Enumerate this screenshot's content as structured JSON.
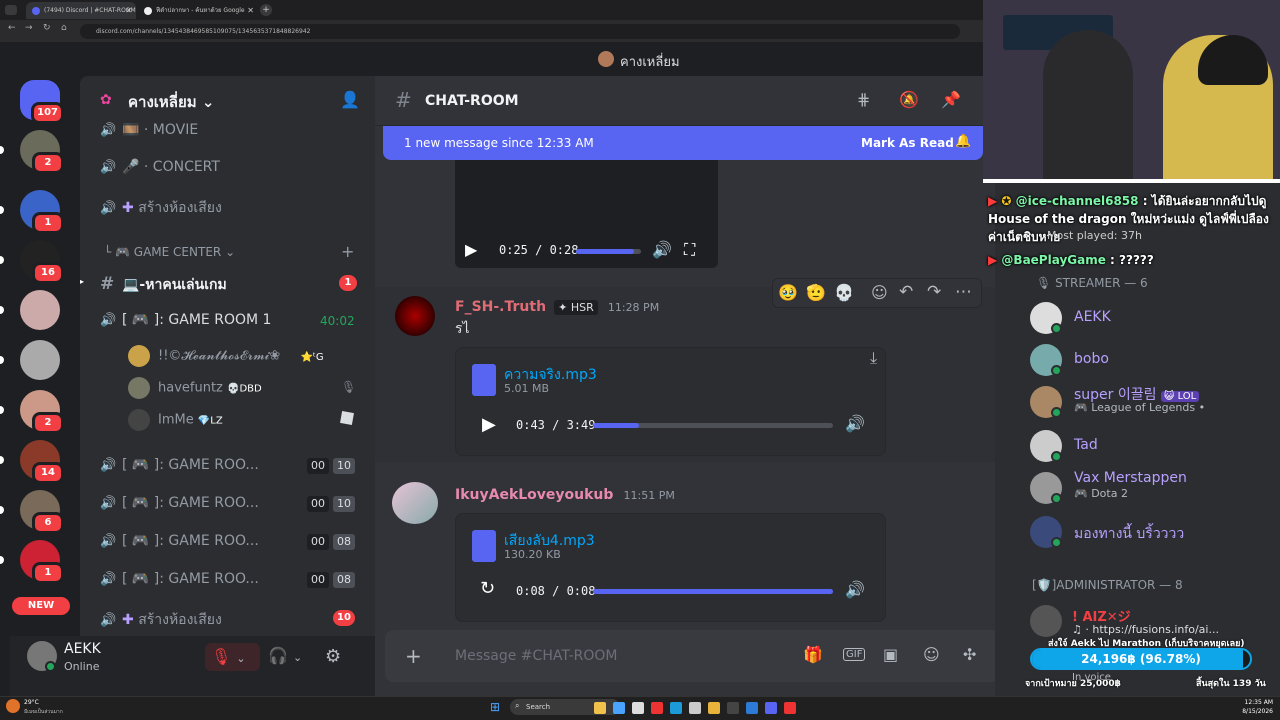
{
  "browser": {
    "tabs": [
      {
        "title": "(7494) Discord | #CHAT-ROOM"
      },
      {
        "title": "ฟีดำปลากษา - ค้นหาด้วย Google"
      }
    ],
    "url": "discord.com/channels/1345438469585109075/1345635371848826942"
  },
  "window": {
    "title": "คางเหลี่ยม"
  },
  "servers": [
    {
      "badge": "107",
      "color": "#5865f2"
    },
    {
      "badge": "2",
      "color": "#6b6b5b"
    },
    {
      "badge": "1",
      "color": "#3a64c8"
    },
    {
      "badge": "16",
      "color": "#222"
    },
    {
      "badge": "",
      "color": "#caa"
    },
    {
      "badge": "",
      "color": "#aaa"
    },
    {
      "badge": "2",
      "color": "#c98"
    },
    {
      "badge": "14",
      "color": "#8b3a2a"
    },
    {
      "badge": "6",
      "color": "#7a6a5a"
    },
    {
      "badge": "1",
      "color": "#c23"
    }
  ],
  "rail_new": "NEW",
  "sidebar": {
    "server_name": "คางเหลี่ยม",
    "voice_top": [
      {
        "icon": "🎞️",
        "label": "MOVIE"
      },
      {
        "icon": "🎤",
        "label": "CONCERT"
      }
    ],
    "create_voice": "สร้างห้องเสียง",
    "category": "GAME CENTER",
    "text_channel": "💻-หาคนเล่นเกม",
    "text_channel_badge": "1",
    "game_room_1": {
      "label": "[ 🎮 ]: GAME ROOM 1",
      "timer": "40:02"
    },
    "voice_users": [
      {
        "name": "!!©𝓗𝓮𝓪𝓷𝓽𝓱𝓸𝓼𝓔𝓻𝓶𝓲❀",
        "tag": "⭐ᵗG"
      },
      {
        "name": "havefuntz",
        "tag": "💀DBD"
      },
      {
        "name": "ImMe",
        "tag": "💎LZ"
      }
    ],
    "game_rooms": [
      {
        "label": "[ 🎮 ]: GAME ROO...",
        "c1": "00",
        "c2": "10"
      },
      {
        "label": "[ 🎮 ]: GAME ROO...",
        "c1": "00",
        "c2": "10"
      },
      {
        "label": "[ 🎮 ]: GAME ROO...",
        "c1": "00",
        "c2": "08"
      },
      {
        "label": "[ 🎮 ]: GAME ROO...",
        "c1": "00",
        "c2": "08"
      }
    ],
    "create_voice_2": "สร้างห้องเสียง",
    "create_voice_2_badge": "10"
  },
  "user_panel": {
    "name": "AEKK",
    "status": "Online"
  },
  "chat": {
    "channel": "CHAT-ROOM",
    "new_message_bar": "1 new message since 12:33 AM",
    "mark_as_read": "Mark As Read",
    "video_time": "0:25 / 0:28",
    "video_progress": 0.89,
    "messages": [
      {
        "author": "F_SH-.Truth",
        "tag": "HSR",
        "time": "11:28 PM",
        "text": "รไ",
        "file": "ความจริง.mp3",
        "size": "5.01 MB",
        "player_time": "0:43 / 3:49",
        "progress": 0.19
      },
      {
        "author": "IkuyAekLoveyoukub",
        "time": "11:51 PM",
        "file": "เสียงลับ4.mp3",
        "size": "130.20 KB",
        "player_time": "0:08 / 0:08",
        "progress": 1.0
      }
    ],
    "composer_placeholder": "Message #CHAT-ROOM"
  },
  "members": {
    "streamer_header": "STREAMER — 6",
    "streamers": [
      {
        "name": "AEKK",
        "sub": ""
      },
      {
        "name": "bobo",
        "sub": ""
      },
      {
        "name": "super 이끌림",
        "tag": "LOL",
        "sub": "League of Legends •"
      },
      {
        "name": "Tad",
        "sub": ""
      },
      {
        "name": "Vax Merstappen",
        "sub": "Dota 2"
      },
      {
        "name": "มองทางนี้ บริ้วววว",
        "sub": ""
      }
    ],
    "admin_header": "[🛡️]ADMINISTRATOR — 8",
    "admin_first": "! AIZ✕ジ",
    "admin_first_sub": "https://fusions.info/ai...",
    "admin_second_sub": "In voice"
  },
  "overlay": {
    "chat1_user": "@ice-channel6858",
    "chat1_text": ": ได้ยินล่ะอยากกลับไปดู House of the dragon ใหม่หว่ะแม่ง ดูไลฟ์พี่เปลืองค่าเน็ตชิบหาย",
    "chat1_extra": "Most played: 37h",
    "chat2_user": "@BaePlayGame",
    "chat2_text": ": ?????",
    "donation_title": "ส่งใจ์ Aekk ไป Marathon (เก็บบริจาคหยุดเลย)",
    "donation_amount": "24,196฿ (96.78%)",
    "donation_progress": 0.9678,
    "donation_goal": "จากเป้าหมาย 25,000฿",
    "donation_days": "สิ้นสุดใน 139 วัน"
  },
  "taskbar": {
    "weather": "29°C",
    "weather_sub": "มีเมฆเป็นส่วนมาก",
    "search": "Search",
    "clock_time": "12:35 AM",
    "clock_date": "8/15/2026"
  }
}
